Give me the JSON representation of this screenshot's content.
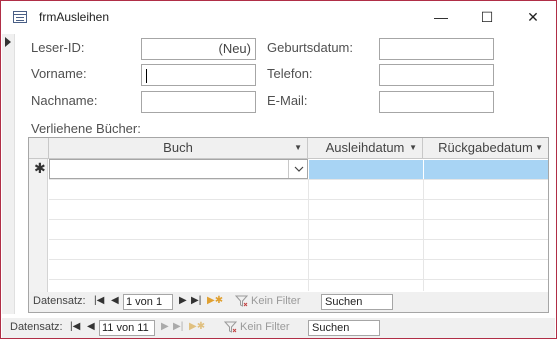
{
  "window": {
    "title": "frmAusleihen",
    "minimize_glyph": "—",
    "maximize_glyph": "☐",
    "close_glyph": "✕"
  },
  "form": {
    "leser_id": {
      "label": "Leser-ID:",
      "value": "(Neu)"
    },
    "vorname": {
      "label": "Vorname:",
      "value": ""
    },
    "nachname": {
      "label": "Nachname:",
      "value": ""
    },
    "geburtsdatum": {
      "label": "Geburtsdatum:",
      "value": ""
    },
    "telefon": {
      "label": "Telefon:",
      "value": ""
    },
    "email": {
      "label": "E-Mail:",
      "value": ""
    },
    "subform_label": "Verliehene Bücher:"
  },
  "datasheet": {
    "columns": [
      "Buch",
      "Ausleihdatum",
      "Rückgabedatum"
    ],
    "new_record_symbol": "✱"
  },
  "sub_nav": {
    "label": "Datensatz:",
    "position": "1 von 1",
    "filter_label": "Kein Filter",
    "search_placeholder": "Suchen"
  },
  "main_nav": {
    "label": "Datensatz:",
    "position": "11 von 11",
    "filter_label": "Kein Filter",
    "search_placeholder": "Suchen"
  },
  "icons": {
    "app": "form-icon",
    "first": "first-record-icon",
    "prev": "previous-record-icon",
    "next": "next-record-icon",
    "last": "last-record-icon",
    "new": "new-record-icon",
    "filter": "filter-icon"
  },
  "colors": {
    "window_border": "#b02e46",
    "selection": "#a8d4f4",
    "header_bg": "#f0f0f0"
  }
}
